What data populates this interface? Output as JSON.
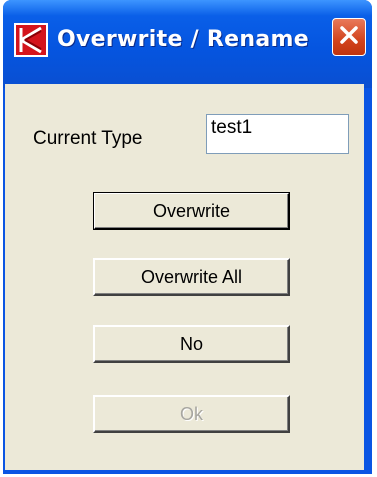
{
  "window": {
    "title": "Overwrite / Rename",
    "app_icon": "red-k-logo-icon",
    "close_icon": "close-icon",
    "accent": "#0a55e3",
    "close_color": "#d2431d"
  },
  "form": {
    "current_type_label": "Current Type",
    "current_type_value": "test1"
  },
  "buttons": {
    "overwrite": "Overwrite",
    "overwrite_all": "Overwrite All",
    "no": "No",
    "ok": "Ok"
  }
}
